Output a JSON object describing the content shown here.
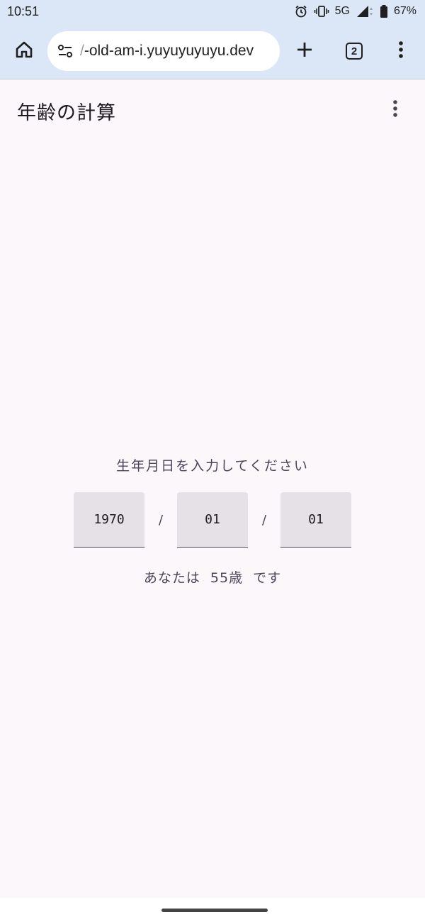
{
  "status_bar": {
    "time": "10:51",
    "network": "5G",
    "battery": "67%",
    "icons": [
      "alarm-icon",
      "vibrate-icon",
      "signal-icon",
      "battery-icon"
    ]
  },
  "browser": {
    "url_prefix": "/",
    "url": "-old-am-i.yuyuyuyuyu.dev",
    "tab_count": "2",
    "icons": [
      "home-icon",
      "site-settings-icon",
      "plus-icon",
      "tabs-icon",
      "more-vert-icon"
    ]
  },
  "app": {
    "title": "年齢の計算",
    "prompt": "生年月日を入力してください",
    "date": {
      "year": "1970",
      "month": "01",
      "day": "01",
      "separator": "/"
    },
    "result": {
      "prefix": "あなたは",
      "age": "55歳",
      "suffix": "です"
    }
  },
  "colors": {
    "chrome_bg": "#dbe7f7",
    "page_bg": "#fcf7fb",
    "field_bg": "#e6e0e7",
    "text": "#1d1b20"
  }
}
